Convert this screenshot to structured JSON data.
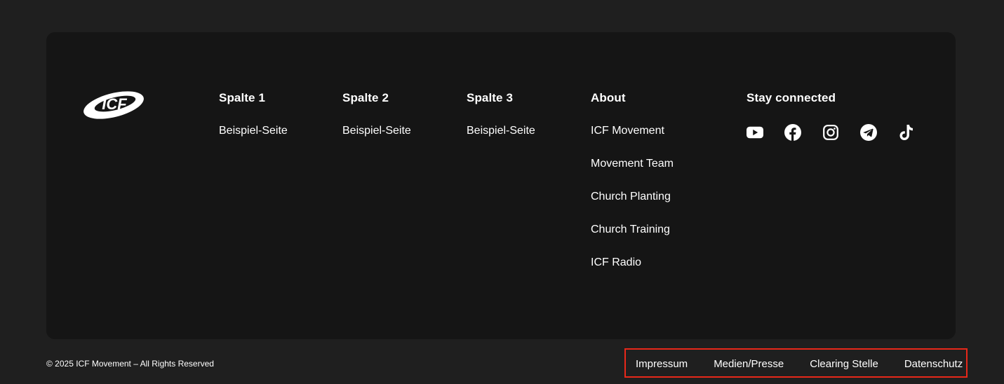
{
  "brand": {
    "logo_text": "ICF"
  },
  "columns": [
    {
      "heading": "Spalte 1",
      "links": [
        "Beispiel-Seite"
      ]
    },
    {
      "heading": "Spalte 2",
      "links": [
        "Beispiel-Seite"
      ]
    },
    {
      "heading": "Spalte 3",
      "links": [
        "Beispiel-Seite"
      ]
    },
    {
      "heading": "About",
      "links": [
        "ICF Movement",
        "Movement Team",
        "Church Planting",
        "Church Training",
        "ICF Radio"
      ]
    }
  ],
  "social": {
    "heading": "Stay connected",
    "icons": [
      "youtube-icon",
      "facebook-icon",
      "instagram-icon",
      "telegram-icon",
      "tiktok-icon"
    ]
  },
  "footer": {
    "copyright": "© 2025 ICF Movement – All Rights Reserved",
    "legal_links": [
      "Impressum",
      "Medien/Presse",
      "Clearing Stelle",
      "Datenschutz"
    ]
  },
  "colors": {
    "page_bg": "#1f1f1f",
    "card_bg": "#151515",
    "highlight_border": "#e8281a"
  }
}
